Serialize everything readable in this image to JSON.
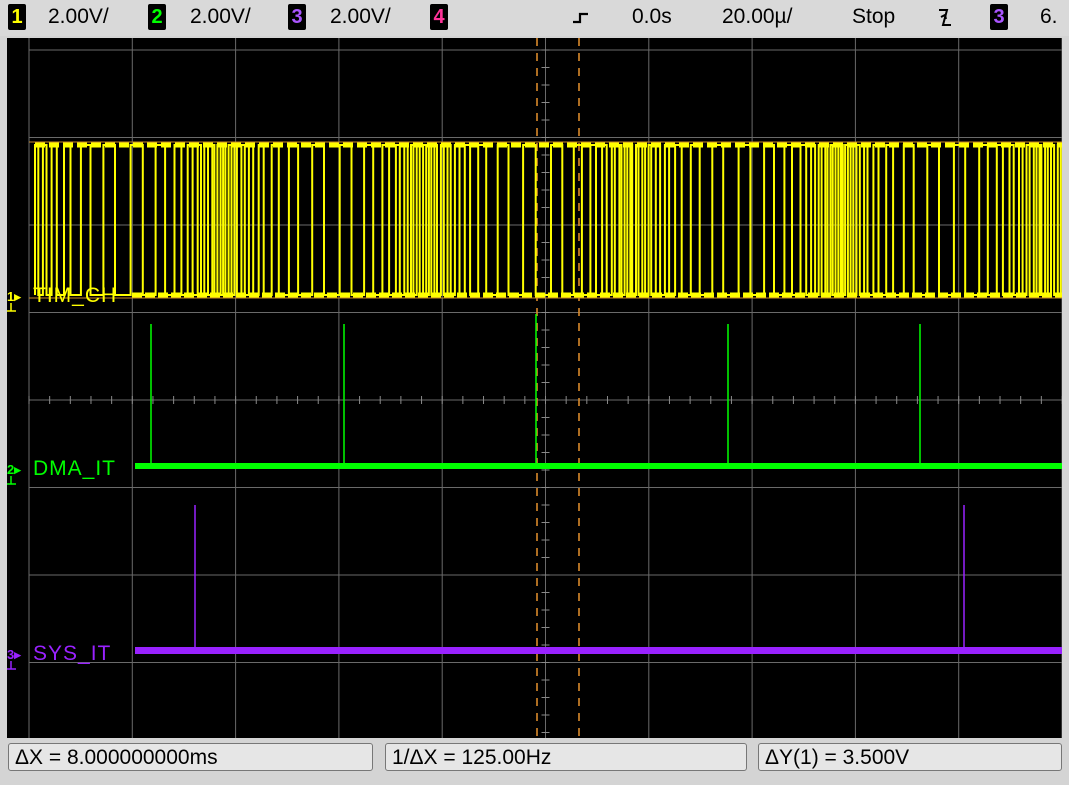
{
  "topbar": {
    "ch1": {
      "num": "1",
      "scale": "2.00V/",
      "color": "#ffff00"
    },
    "ch2": {
      "num": "2",
      "scale": "2.00V/",
      "color": "#00ff00"
    },
    "ch3": {
      "num": "3",
      "scale": "2.00V/",
      "color": "#9933ff"
    },
    "ch4": {
      "num": "4",
      "color": "#ff3399"
    },
    "delay": "0.0s",
    "timebase": "20.00µ/",
    "run_state": "Stop",
    "trigger_slope": "falling-edge-icon",
    "trigger_source": "3",
    "trigger_level": "6."
  },
  "channels": [
    {
      "num": "1",
      "label": "TIM_CH",
      "color": "#ffff00"
    },
    {
      "num": "2",
      "label": "DMA_IT",
      "color": "#00ff00"
    },
    {
      "num": "3",
      "label": "SYS_IT",
      "color": "#9922ff"
    }
  ],
  "measurements": {
    "delta_x": "ΔX = 8.000000000ms",
    "inv_delta_x": "1/ΔX = 125.00Hz",
    "delta_y": "ΔY(1) = 3.500V"
  }
}
